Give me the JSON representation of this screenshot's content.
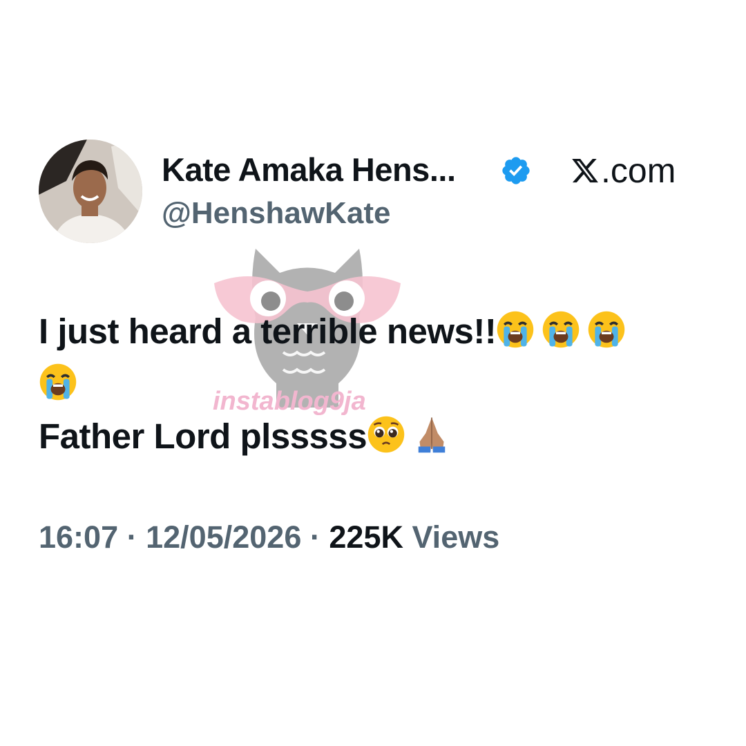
{
  "author": {
    "display_name": "Kate Amaka Hens...",
    "handle": "@HenshawKate",
    "verified_icon": "verified-badge-icon",
    "avatar": "profile-photo"
  },
  "brand": {
    "label": ".com",
    "icon": "x-logo-icon"
  },
  "watermark": {
    "text": "instablog9ja",
    "icon": "owl-glasses-logo"
  },
  "tweet": {
    "line1_text": "I just heard a terrible news!!",
    "line1_emojis": [
      "loudly-crying-face-emoji",
      "loudly-crying-face-emoji",
      "loudly-crying-face-emoji",
      "loudly-crying-face-emoji"
    ],
    "line2_text": "Father Lord plsssss",
    "line2_emojis": [
      "pleading-face-emoji",
      "folded-hands-emoji"
    ]
  },
  "meta": {
    "time": "16:07",
    "separator": "·",
    "date": "12/05/2026",
    "views_count": "225K",
    "views_label": "Views"
  },
  "colors": {
    "text_primary": "#0f1419",
    "text_secondary": "#536471",
    "verified_blue": "#1d9bf0",
    "watermark_pink": "#f2b6cf",
    "watermark_gray": "#8e8e8e"
  }
}
